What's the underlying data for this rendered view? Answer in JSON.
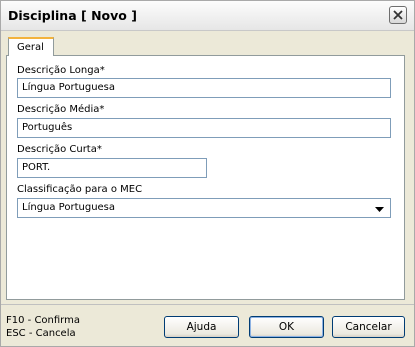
{
  "window": {
    "title": "Disciplina [ Novo ]"
  },
  "tabs": [
    {
      "label": "Geral"
    }
  ],
  "form": {
    "descricao_longa": {
      "label": "Descrição Longa*",
      "value": "Língua Portuguesa"
    },
    "descricao_media": {
      "label": "Descrição Média*",
      "value": "Português"
    },
    "descricao_curta": {
      "label": "Descrição Curta*",
      "value": "PORT."
    },
    "classificacao_mec": {
      "label": "Classificação para o MEC",
      "value": "Língua Portuguesa"
    }
  },
  "shortcuts": {
    "confirm": "F10 - Confirma",
    "cancel": "ESC - Cancela"
  },
  "buttons": {
    "help": "Ajuda",
    "ok": "OK",
    "cancel": "Cancelar"
  }
}
